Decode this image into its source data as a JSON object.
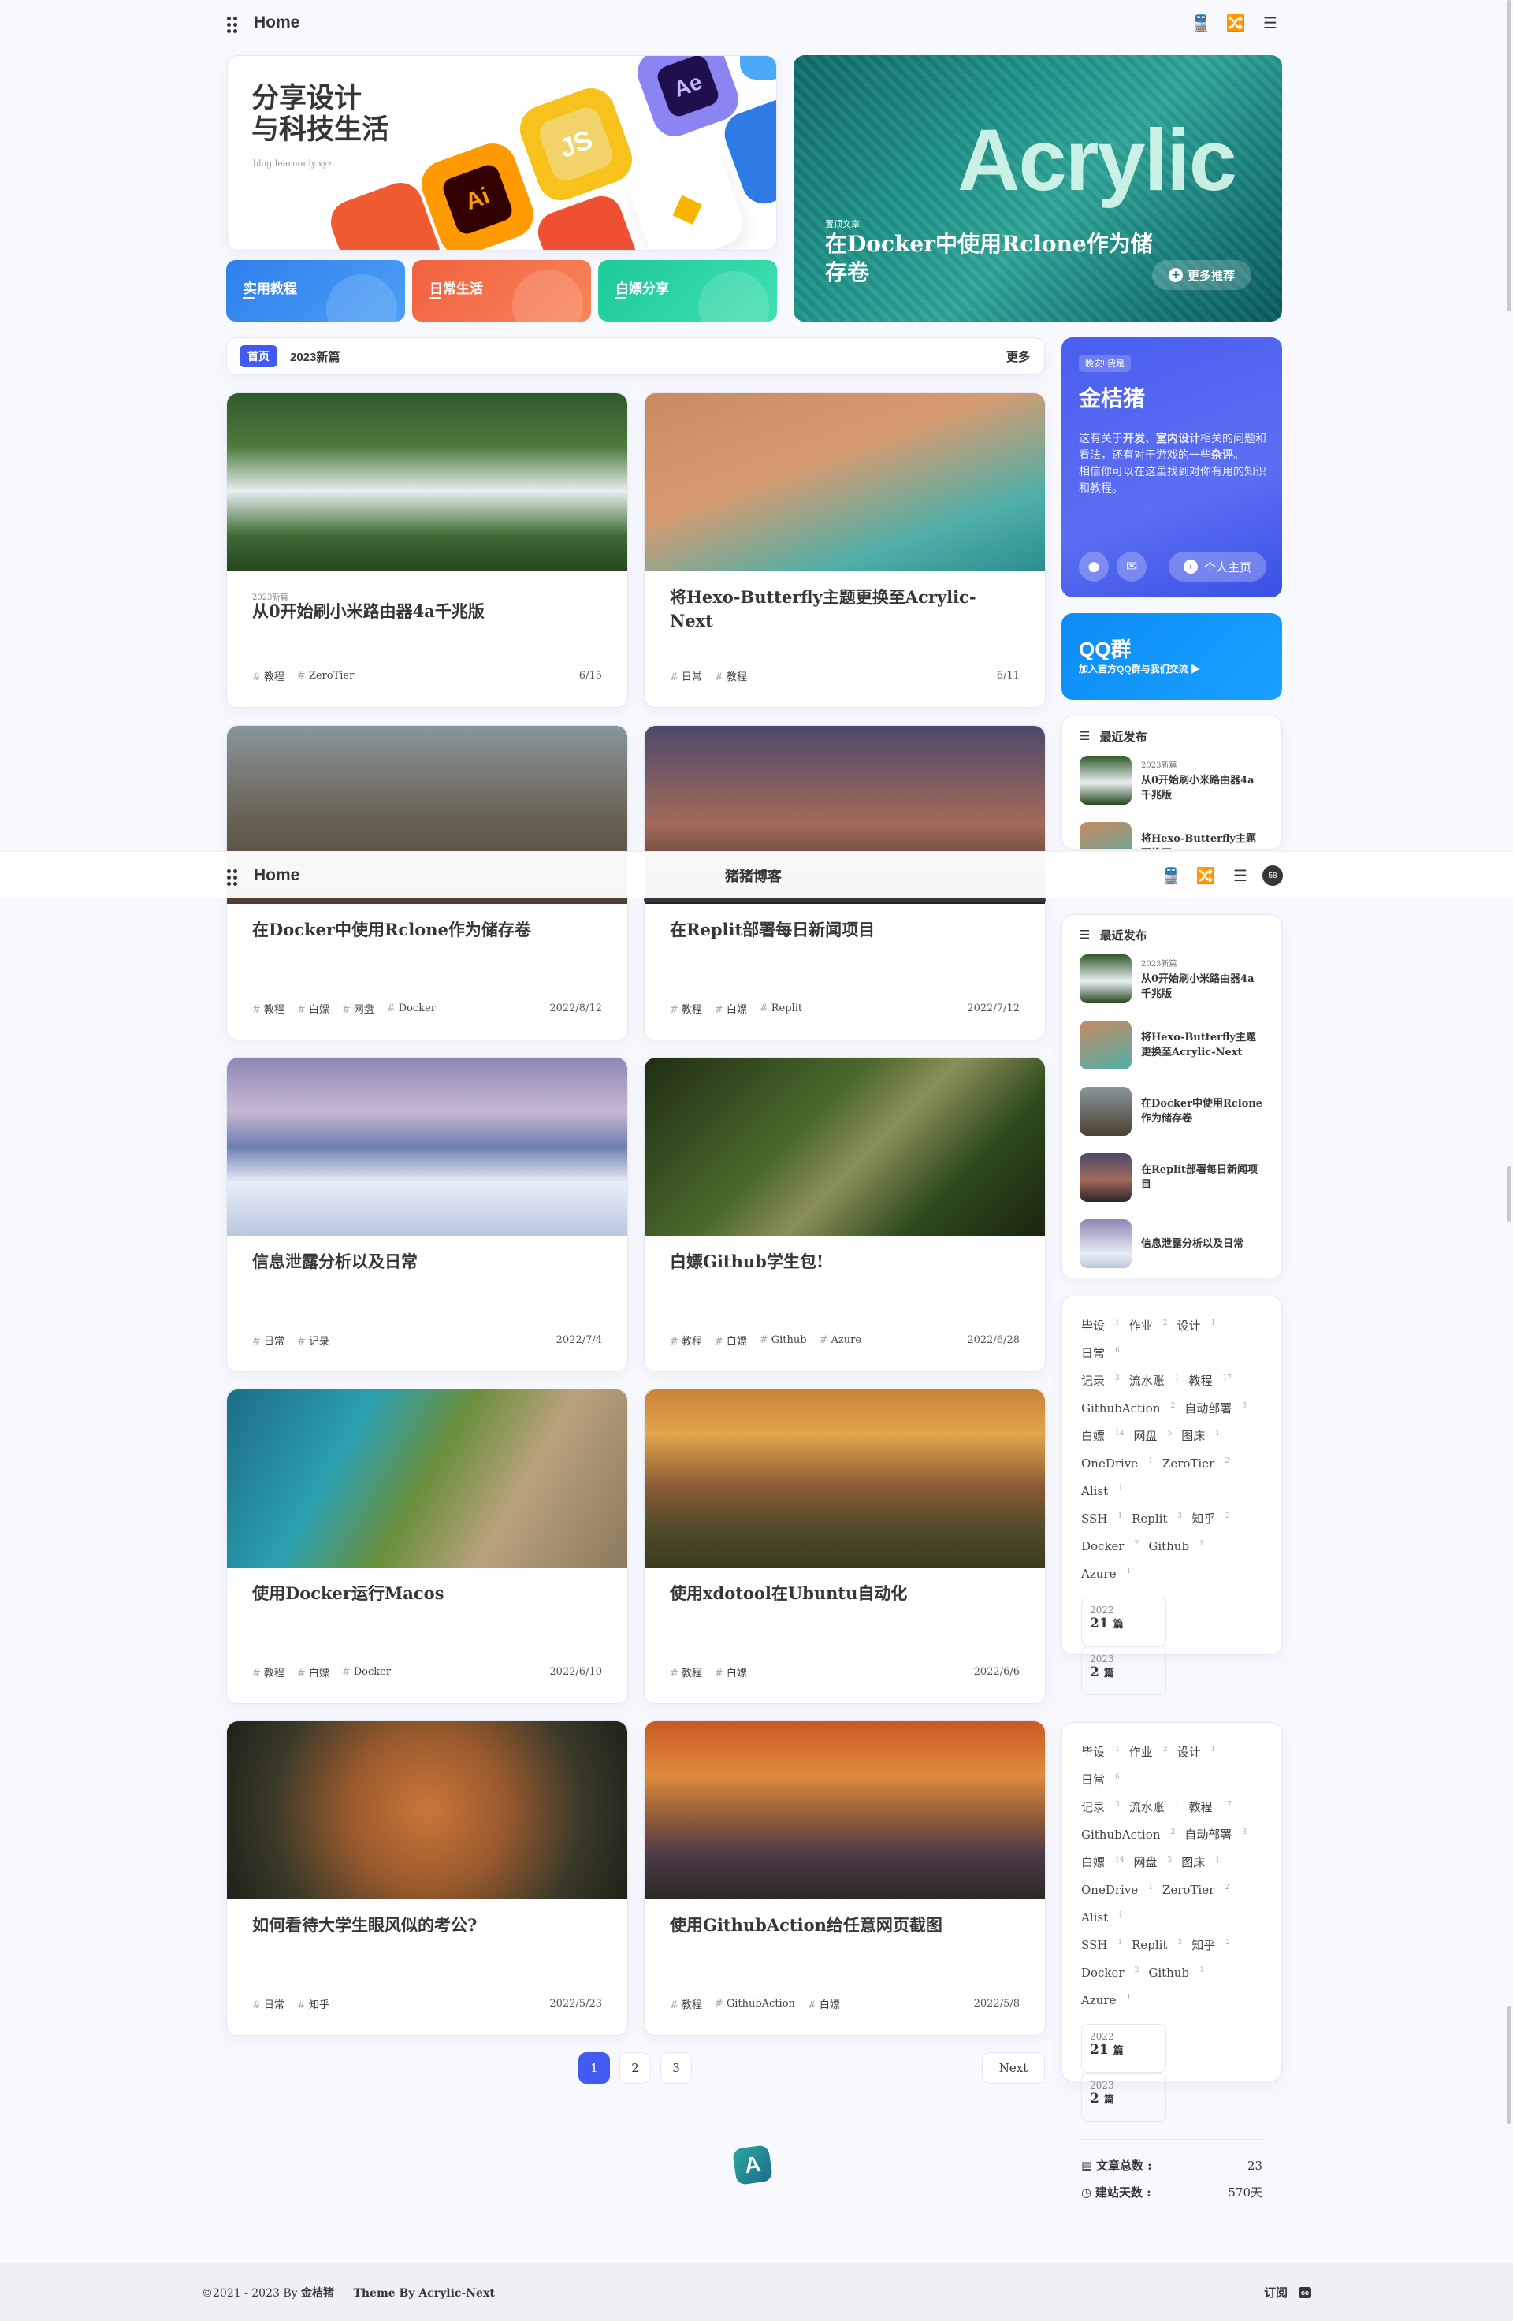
{
  "nav": {
    "title": "Home",
    "site_name": "猪猪博客",
    "badge": "58"
  },
  "hero": {
    "slogan_line1": "分享设计",
    "slogan_line2": "与科技生活",
    "domain": "blog.learnonly.xyz",
    "app_icons": [
      "Ai",
      "JS",
      "Ae"
    ],
    "categories": [
      {
        "label": "实用教程",
        "color": "#2f80ed"
      },
      {
        "label": "日常生活",
        "color": "#f2613f"
      },
      {
        "label": "白嫖分享",
        "color": "#1dc99a"
      }
    ],
    "featured": {
      "kicker": "置顶文章",
      "title_line1": "在Docker中使用Rclone作为储",
      "title_line2": "存卷",
      "big_word": "Acrylic",
      "more_label": "更多推荐"
    }
  },
  "announce": {
    "badge": "首页",
    "text": "2023新篇",
    "more": "更多"
  },
  "posts": [
    {
      "category": "2023新篇",
      "title": "从0开始刷小米路由器4a千兆版",
      "tags": [
        "教程",
        "ZeroTier"
      ],
      "date": "6/15",
      "img": "linear-gradient(180deg,#2f5a2a 0%,#4d7b3d 30%,#e8eef0 55%,#3c6b33 80%,#26461f 100%)"
    },
    {
      "category": "",
      "title": "将Hexo-Butterfly主题更换至Acrylic-Next",
      "tags": [
        "日常",
        "教程"
      ],
      "date": "6/11",
      "img": "linear-gradient(160deg,#c98a62 0%,#d79a70 40%,#4fb0a8 75%,#2a8e8b 100%)"
    },
    {
      "category": "",
      "title": "在Docker中使用Rclone作为储存卷",
      "tags": [
        "教程",
        "白嫖",
        "网盘",
        "Docker"
      ],
      "date": "2022/8/12",
      "img": "linear-gradient(180deg,#88969c 0%,#6a6456 50%,#4e4032 100%)"
    },
    {
      "category": "",
      "title": "在Replit部署每日新闻项目",
      "tags": [
        "教程",
        "白嫖",
        "Replit"
      ],
      "date": "2022/7/12",
      "img": "linear-gradient(180deg,#4c4a6b 0%,#a36a5a 55%,#2b2327 100%)"
    },
    {
      "category": "",
      "title": "信息泄露分析以及日常",
      "tags": [
        "日常",
        "记录"
      ],
      "date": "2022/7/4",
      "img": "linear-gradient(180deg,#8d86b3 0%,#c7b8d2 30%,#6d7fb0 50%,#e8eef7 70%,#b9c7dd 100%)"
    },
    {
      "category": "",
      "title": "白嫖Github学生包!",
      "tags": [
        "教程",
        "白嫖",
        "Github",
        "Azure"
      ],
      "date": "2022/6/28",
      "img": "linear-gradient(135deg,#1f2d14 0%,#4c6a2c 40%,#8b8f5a 55%,#2f4a1c 75%,#1a2510 100%)"
    },
    {
      "category": "",
      "title": "使用Docker运行Macos",
      "tags": [
        "教程",
        "白嫖",
        "Docker"
      ],
      "date": "2022/6/10",
      "img": "linear-gradient(120deg,#1c6d86 0%,#2ba0b0 30%,#6a8f3c 50%,#b9a27d 70%,#8a7a5c 100%)"
    },
    {
      "category": "",
      "title": "使用xdotool在Ubuntu自动化",
      "tags": [
        "教程",
        "白嫖"
      ],
      "date": "2022/6/6",
      "img": "linear-gradient(180deg,#c9823a 0%,#e2a54a 25%,#8a5a35 55%,#4d4a28 80%,#3b3b1f 100%)"
    },
    {
      "category": "",
      "title": "如何看待大学生眼风似的考公?",
      "tags": [
        "日常",
        "知乎"
      ],
      "date": "2022/5/23",
      "img": "radial-gradient(circle at 50% 50%,#c9773a 0%,#9b5a2c 35%,#3b3a2a 70%,#1f2118 100%)"
    },
    {
      "category": "",
      "title": "使用GithubAction给任意网页截图",
      "tags": [
        "教程",
        "GithubAction",
        "白嫖"
      ],
      "date": "2022/5/8",
      "img": "linear-gradient(180deg,#c95a24 0%,#e08a3a 30%,#8e5a3a 55%,#4d3a4a 75%,#2b2a22 100%)"
    }
  ],
  "author": {
    "badge": "晚安! 我是",
    "name": "金桔猪",
    "desc_line1_a": "这有关于",
    "desc_bold1": "开发",
    "desc_mid": "、",
    "desc_bold2": "室内设计",
    "desc_line1_b": "相关的问题和看法，还有对于游戏的一些",
    "desc_bold3": "杂评",
    "desc_end": "。",
    "desc_line2": "相信你可以在这里找到对你有用的知识和教程。",
    "home_label": "个人主页"
  },
  "qq": {
    "title": "QQ群",
    "subtitle": "加入官方QQ群与我们交流 ▶"
  },
  "recent": {
    "heading": "最近发布",
    "items": [
      {
        "small": "2023新篇",
        "title": "从0开始刷小米路由器4a千兆版"
      },
      {
        "small": "",
        "title": "将Hexo-Butterfly主题更换至Acrylic-Next"
      },
      {
        "small": "",
        "title": "在Docker中使用Rclone作为储存卷"
      },
      {
        "small": "",
        "title": "在Replit部署每日新闻项目"
      },
      {
        "small": "",
        "title": "信息泄露分析以及日常"
      }
    ]
  },
  "tags": [
    {
      "name": "毕设",
      "count": "1"
    },
    {
      "name": "作业",
      "count": "2"
    },
    {
      "name": "设计",
      "count": "1"
    },
    {
      "name": "日常",
      "count": "6"
    },
    {
      "name": "记录",
      "count": "3"
    },
    {
      "name": "流水账",
      "count": "1"
    },
    {
      "name": "教程",
      "count": "17"
    },
    {
      "name": "GithubAction",
      "count": "2"
    },
    {
      "name": "自动部署",
      "count": "3"
    },
    {
      "name": "白嫖",
      "count": "14"
    },
    {
      "name": "网盘",
      "count": "5"
    },
    {
      "name": "图床",
      "count": "1"
    },
    {
      "name": "OneDrive",
      "count": "1"
    },
    {
      "name": "ZeroTier",
      "count": "2"
    },
    {
      "name": "Alist",
      "count": "1"
    },
    {
      "name": "SSH",
      "count": "1"
    },
    {
      "name": "Replit",
      "count": "3"
    },
    {
      "name": "知乎",
      "count": "2"
    },
    {
      "name": "Docker",
      "count": "2"
    },
    {
      "name": "Github",
      "count": "1"
    },
    {
      "name": "Azure",
      "count": "1"
    }
  ],
  "archives": [
    {
      "year": "2022",
      "count": "21",
      "unit": "篇"
    },
    {
      "year": "2023",
      "count": "2",
      "unit": "篇"
    }
  ],
  "stats": {
    "posts_label": "文章总数 :",
    "posts_value": "23",
    "days_label": "建站天数 :",
    "days_value": "570天"
  },
  "pagination": {
    "pages": [
      "1",
      "2",
      "3"
    ],
    "next": "Next"
  },
  "footer": {
    "copyright": "©2021 - 2023 By",
    "author": "金桔猪",
    "theme": "Theme By Acrylic-Next",
    "rss": "订阅",
    "cc": "cc"
  }
}
